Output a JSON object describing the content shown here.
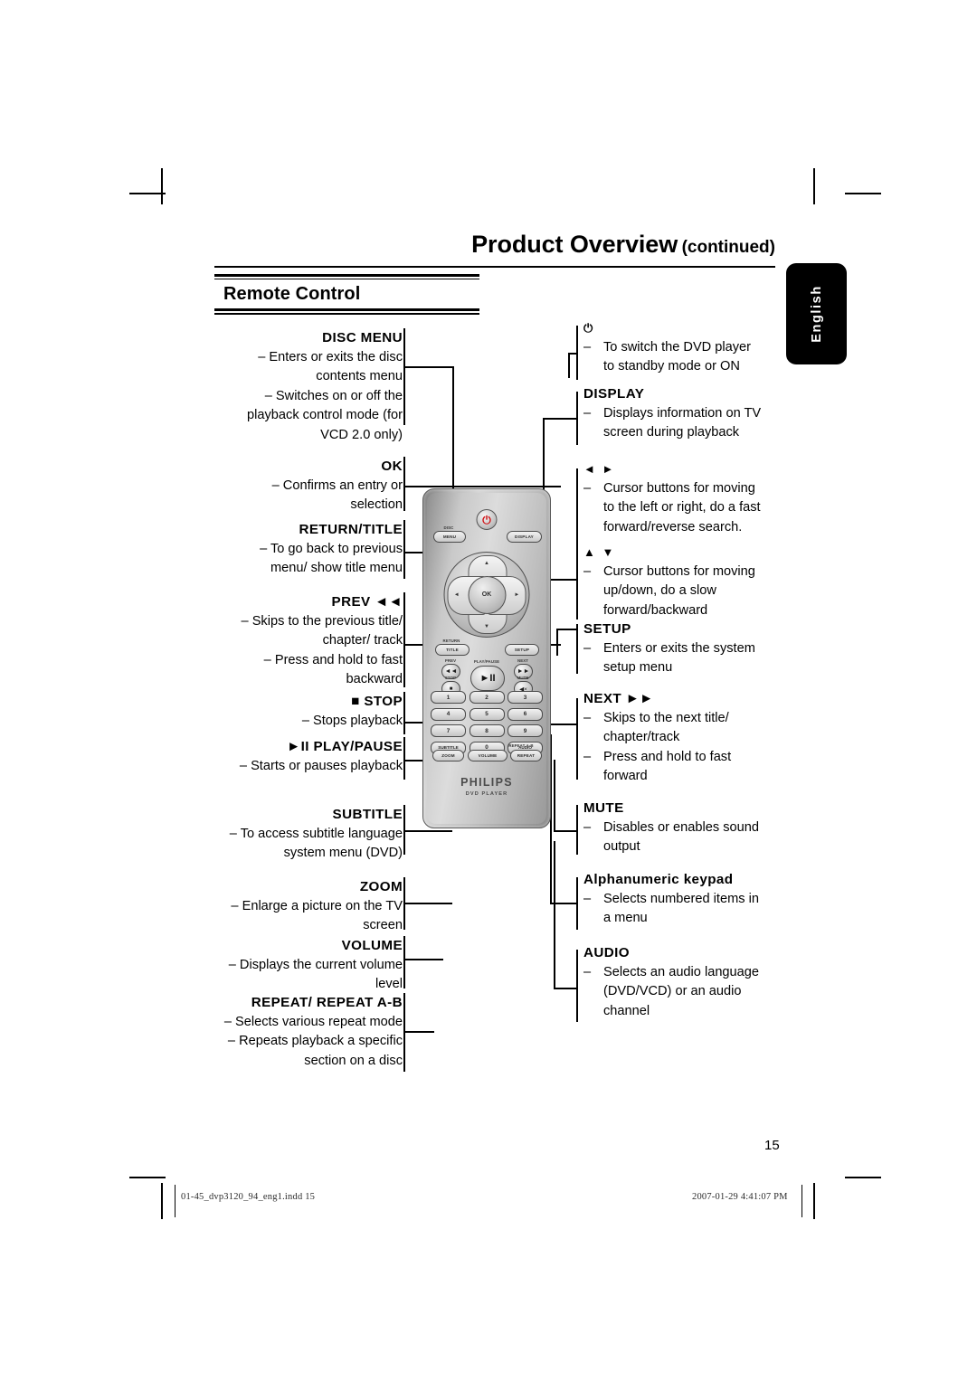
{
  "header": {
    "title_main": "Product Overview",
    "title_sub": "(continued)"
  },
  "section": {
    "heading": "Remote Control"
  },
  "language_tab": {
    "label": "English"
  },
  "left_annotations": [
    {
      "key": "disc-menu",
      "heading": "DISC MENU",
      "lines": [
        "– Enters or exits the disc",
        "contents menu",
        "– Switches on or off the",
        "playback control mode (for",
        "VCD 2.0 only)"
      ]
    },
    {
      "key": "ok",
      "heading": "OK",
      "lines": [
        "– Confirms an entry or",
        "selection"
      ]
    },
    {
      "key": "return-title",
      "heading": "RETURN/TITLE",
      "lines": [
        "– To go back to previous",
        "menu/ show title menu"
      ]
    },
    {
      "key": "prev",
      "heading": "PREV ◄◄",
      "lines": [
        "– Skips to the previous title/",
        "chapter/ track",
        "– Press and hold to fast",
        "backward"
      ]
    },
    {
      "key": "stop",
      "heading": "■ STOP",
      "lines": [
        "– Stops playback"
      ]
    },
    {
      "key": "play-pause",
      "heading": "►II PLAY/PAUSE",
      "lines": [
        "– Starts or pauses playback"
      ]
    },
    {
      "key": "subtitle",
      "heading": "SUBTITLE",
      "lines": [
        "– To access subtitle language",
        "system menu (DVD)"
      ]
    },
    {
      "key": "zoom",
      "heading": "ZOOM",
      "lines": [
        "– Enlarge a picture on the TV",
        "screen"
      ]
    },
    {
      "key": "volume",
      "heading": "VOLUME",
      "lines": [
        "– Displays the current volume",
        "level"
      ]
    },
    {
      "key": "repeat",
      "heading": "REPEAT/ REPEAT A-B",
      "lines": [
        "– Selects various repeat mode",
        "– Repeats playback a specific",
        "section on a disc"
      ]
    }
  ],
  "right_annotations": [
    {
      "key": "standby",
      "heading": "⏻",
      "heading_is_icon": true,
      "lines": [
        "To switch the DVD player",
        "to standby mode or ON"
      ]
    },
    {
      "key": "display",
      "heading": "DISPLAY",
      "lines": [
        "Displays information on TV",
        "screen during playback"
      ]
    },
    {
      "key": "cursor-left-right",
      "heading": "◄ ►",
      "heading_is_icon": true,
      "lines": [
        "Cursor buttons for moving",
        "to the left or right, do a fast",
        "forward/reverse search."
      ]
    },
    {
      "key": "cursor-up-down",
      "heading": "▲ ▼",
      "heading_is_icon": true,
      "lines": [
        "Cursor buttons for moving",
        "up/down, do a slow",
        "forward/backward"
      ]
    },
    {
      "key": "setup",
      "heading": "SETUP",
      "lines": [
        "Enters or exits the system",
        "setup menu"
      ]
    },
    {
      "key": "next",
      "heading": "NEXT ►►",
      "lines": [
        "Skips to the next title/",
        "chapter/track",
        "Press and hold to fast",
        "forward"
      ],
      "dash_lines": [
        0,
        2
      ]
    },
    {
      "key": "mute",
      "heading": "MUTE",
      "lines": [
        "Disables or enables sound",
        "output"
      ]
    },
    {
      "key": "alphanumeric-keypad",
      "heading": "Alphanumeric keypad",
      "lines": [
        "Selects numbered items in",
        "a menu"
      ]
    },
    {
      "key": "audio",
      "heading": "AUDIO",
      "lines": [
        "Selects an audio language",
        "(DVD/VCD) or an audio",
        "channel"
      ]
    }
  ],
  "remote": {
    "power_glyph": "⏻",
    "disc_label_top": "DISC",
    "disc_label_bottom": "MENU",
    "display_label": "DISPLAY",
    "ok_label": "OK",
    "arrow_up": "▲",
    "arrow_down": "▼",
    "arrow_left": "◄",
    "arrow_right": "►",
    "return_label_top": "RETURN",
    "return_label_bottom": "TITLE",
    "setup_label": "SETUP",
    "prev_label": "PREV",
    "prev_glyph": "◄◄",
    "playpause_label": "PLAY/PAUSE",
    "playpause_glyph": "►II",
    "next_label": "NEXT",
    "next_glyph": "►►",
    "stop_label": "STOP",
    "stop_glyph": "■",
    "mute_label": "MUTE",
    "mute_glyph": "🔇",
    "keypad": [
      [
        "1",
        "2",
        "3"
      ],
      [
        "4",
        "5",
        "6"
      ],
      [
        "7",
        "8",
        "9"
      ],
      [
        "SUBTITLE",
        "0",
        "AUDIO"
      ]
    ],
    "repeat_ab_label": "REPEAT A-B",
    "zoom_label": "ZOOM",
    "volume_label": "VOLUME",
    "repeat_label": "REPEAT",
    "brand": "PHILIPS",
    "product": "DVD PLAYER"
  },
  "page_number": "15",
  "footer": {
    "file": "01-45_dvp3120_94_eng1.indd   15",
    "timestamp": "2007-01-29   4:41:07 PM"
  }
}
